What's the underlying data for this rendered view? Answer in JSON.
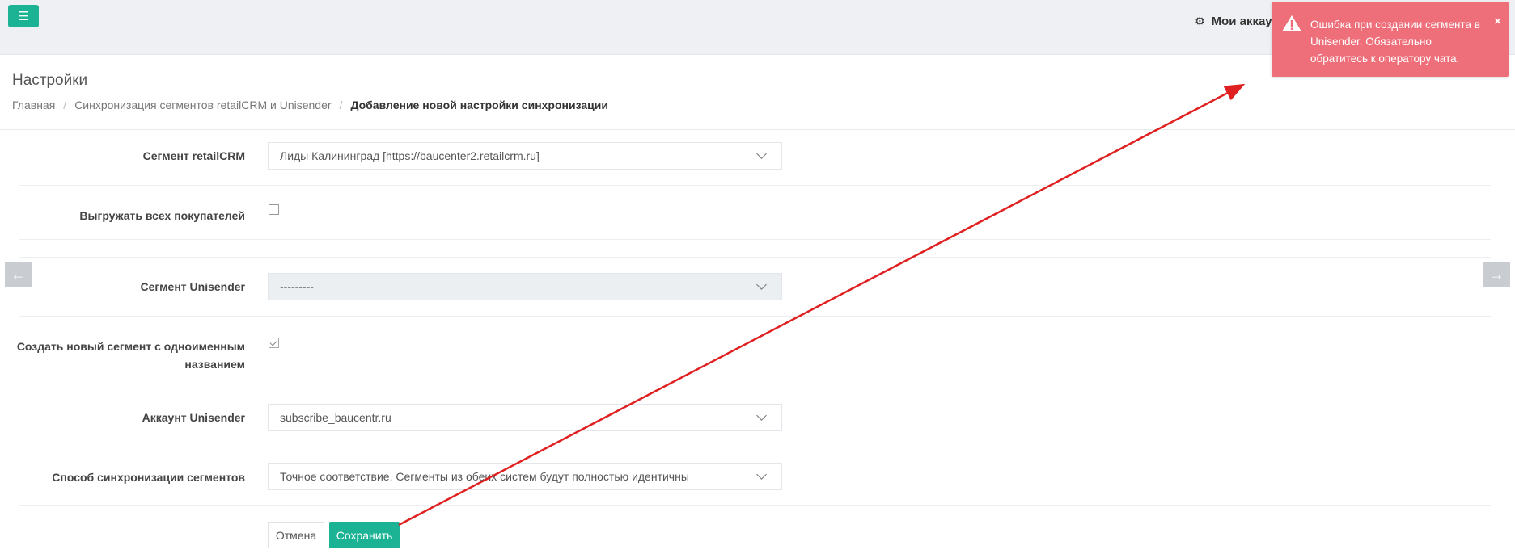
{
  "header": {
    "menu_icon": "hamburger-icon",
    "accounts_icon": "gears-icon",
    "accounts_label": "Мои аккау"
  },
  "page": {
    "title": "Настройки",
    "breadcrumb": [
      "Главная",
      "Синхронизация сегментов retailCRM и Unisender",
      "Добавление новой настройки синхронизации"
    ]
  },
  "form": {
    "segment_retailcrm": {
      "label": "Сегмент retailCRM",
      "value": "Лиды Калининград [https://baucenter2.retailcrm.ru]"
    },
    "export_all": {
      "label": "Выгружать всех покупателей",
      "checked": false
    },
    "segment_unisender": {
      "label": "Сегмент Unisender",
      "value": "---------",
      "disabled": true
    },
    "create_new": {
      "label_line1": "Создать новый сегмент с одноименным",
      "label_line2": "названием",
      "checked": true
    },
    "account_unisender": {
      "label": "Аккаунт Unisender",
      "value": "subscribe_baucentr.ru"
    },
    "sync_mode": {
      "label": "Способ синхронизации сегментов",
      "value": "Точное соответствие. Сегменты из обеих систем будут полностью идентичны"
    },
    "cancel_label": "Отмена",
    "save_label": "Сохранить"
  },
  "nav": {
    "prev_icon": "arrow-left-icon",
    "next_icon": "arrow-right-icon"
  },
  "toast": {
    "icon": "warning-icon",
    "lines": [
      "Ошибка при создании сегмента в",
      "Unisender. Обязательно",
      "обратитесь к оператору чата."
    ],
    "close": "×"
  },
  "colors": {
    "accent": "#1bb394",
    "error": "#ee6f7a",
    "annotation": "#e02020"
  }
}
